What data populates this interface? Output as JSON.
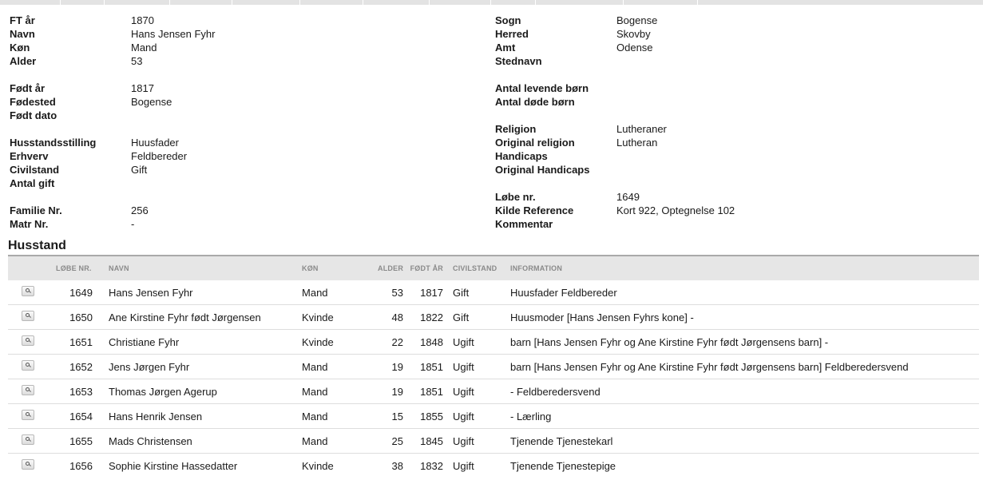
{
  "person": {
    "left": [
      {
        "label": "FT år",
        "value": "1870"
      },
      {
        "label": "Navn",
        "value": "Hans Jensen Fyhr"
      },
      {
        "label": "Køn",
        "value": "Mand"
      },
      {
        "label": "Alder",
        "value": "53"
      },
      {
        "gap": true
      },
      {
        "label": "Født år",
        "value": "1817"
      },
      {
        "label": "Fødested",
        "value": "Bogense"
      },
      {
        "label": "Født dato",
        "value": ""
      },
      {
        "gap": true
      },
      {
        "label": "Husstandsstilling",
        "value": "Huusfader"
      },
      {
        "label": "Erhverv",
        "value": "Feldbereder"
      },
      {
        "label": "Civilstand",
        "value": "Gift"
      },
      {
        "label": "Antal gift",
        "value": ""
      },
      {
        "gap": true
      },
      {
        "label": "Familie Nr.",
        "value": "256"
      },
      {
        "label": "Matr Nr.",
        "value": "-"
      }
    ],
    "right": [
      {
        "label": "Sogn",
        "value": "Bogense"
      },
      {
        "label": "Herred",
        "value": "Skovby"
      },
      {
        "label": "Amt",
        "value": "Odense"
      },
      {
        "label": "Stednavn",
        "value": ""
      },
      {
        "gap": true
      },
      {
        "label": "Antal levende børn",
        "value": ""
      },
      {
        "label": "Antal døde børn",
        "value": ""
      },
      {
        "gap": true
      },
      {
        "label": "Religion",
        "value": "Lutheraner"
      },
      {
        "label": "Original religion",
        "value": "Lutheran"
      },
      {
        "label": "Handicaps",
        "value": ""
      },
      {
        "label": "Original Handicaps",
        "value": ""
      },
      {
        "gap": true
      },
      {
        "label": "Løbe nr.",
        "value": "1649"
      },
      {
        "label": "Kilde Reference",
        "value": "Kort 922, Optegnelse 102"
      },
      {
        "label": "Kommentar",
        "value": ""
      }
    ]
  },
  "household": {
    "title": "Husstand",
    "columns": [
      "LØBE NR.",
      "NAVN",
      "KØN",
      "ALDER",
      "FØDT ÅR",
      "CIVILSTAND",
      "INFORMATION"
    ],
    "rows": [
      {
        "nr": "1649",
        "navn": "Hans Jensen Fyhr",
        "kon": "Mand",
        "alder": "53",
        "fodt": "1817",
        "civil": "Gift",
        "info": "Huusfader Feldbereder"
      },
      {
        "nr": "1650",
        "navn": "Ane Kirstine Fyhr født Jørgensen",
        "kon": "Kvinde",
        "alder": "48",
        "fodt": "1822",
        "civil": "Gift",
        "info": "Huusmoder [Hans Jensen Fyhrs kone] -"
      },
      {
        "nr": "1651",
        "navn": "Christiane Fyhr",
        "kon": "Kvinde",
        "alder": "22",
        "fodt": "1848",
        "civil": "Ugift",
        "info": "barn [Hans Jensen Fyhr og Ane Kirstine Fyhr født Jørgensens barn] -"
      },
      {
        "nr": "1652",
        "navn": "Jens Jørgen Fyhr",
        "kon": "Mand",
        "alder": "19",
        "fodt": "1851",
        "civil": "Ugift",
        "info": "barn [Hans Jensen Fyhr og Ane Kirstine Fyhr født Jørgensens barn] Feldberedersvend"
      },
      {
        "nr": "1653",
        "navn": "Thomas Jørgen Agerup",
        "kon": "Mand",
        "alder": "19",
        "fodt": "1851",
        "civil": "Ugift",
        "info": "- Feldberedersvend"
      },
      {
        "nr": "1654",
        "navn": "Hans Henrik Jensen",
        "kon": "Mand",
        "alder": "15",
        "fodt": "1855",
        "civil": "Ugift",
        "info": "- Lærling"
      },
      {
        "nr": "1655",
        "navn": "Mads Christensen",
        "kon": "Mand",
        "alder": "25",
        "fodt": "1845",
        "civil": "Ugift",
        "info": "Tjenende Tjenestekarl"
      },
      {
        "nr": "1656",
        "navn": "Sophie Kirstine Hassedatter",
        "kon": "Kvinde",
        "alder": "38",
        "fodt": "1832",
        "civil": "Ugift",
        "info": "Tjenende Tjenestepige"
      }
    ]
  }
}
